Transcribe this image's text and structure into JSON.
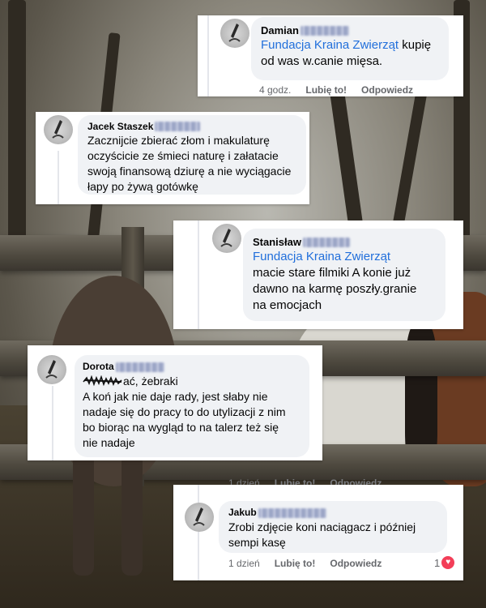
{
  "comments": [
    {
      "author": "Damian",
      "mention": "Fundacja Kraina Zwierząt",
      "line1_rest": " kupię",
      "line2": "od was w.canie mięsa.",
      "time": "4 godz.",
      "like": "Lubię to!",
      "reply": "Odpowiedz"
    },
    {
      "author": "Jacek Staszek",
      "lines": [
        "Zacznijcie zbierać złom i makulaturę",
        "oczyścicie ze śmieci naturę i załatacie",
        "swoją finansową dziurę a nie wyciągacie",
        "łapy po żywą gotówkę"
      ]
    },
    {
      "author": "Stanisław",
      "mention": "Fundacja Kraina Zwierząt",
      "lines": [
        "macie stare filmiki A konie już",
        "dawno na karmę poszły.granie",
        "na emocjach"
      ]
    },
    {
      "author": "Dorota",
      "line1_rest": "ać, żebraki",
      "lines": [
        "A koń jak nie daje rady, jest słaby nie",
        "nadaje się do pracy to do utylizacji z nim",
        "bo biorąc na wygląd to na talerz też się",
        "nie nadaje"
      ]
    },
    {
      "author": "Jakub",
      "lines": [
        "Zrobi zdjęcie koni naciągacz i później",
        "sempi kasę"
      ],
      "time": "1 dzień",
      "like": "Lubię to!",
      "reply": "Odpowiedz",
      "reactions": "1",
      "behind_time": "1 dzień",
      "behind_like": "Lubię to!",
      "behind_reply": "Odpowiedz"
    }
  ],
  "colors": {
    "link": "#216fdb",
    "bubble": "#f0f2f5",
    "meta": "#65676b",
    "heart": "#f33e58"
  },
  "icons": {
    "avatar": "blurred-profile-avatar-icon",
    "reaction": "heart-icon"
  }
}
